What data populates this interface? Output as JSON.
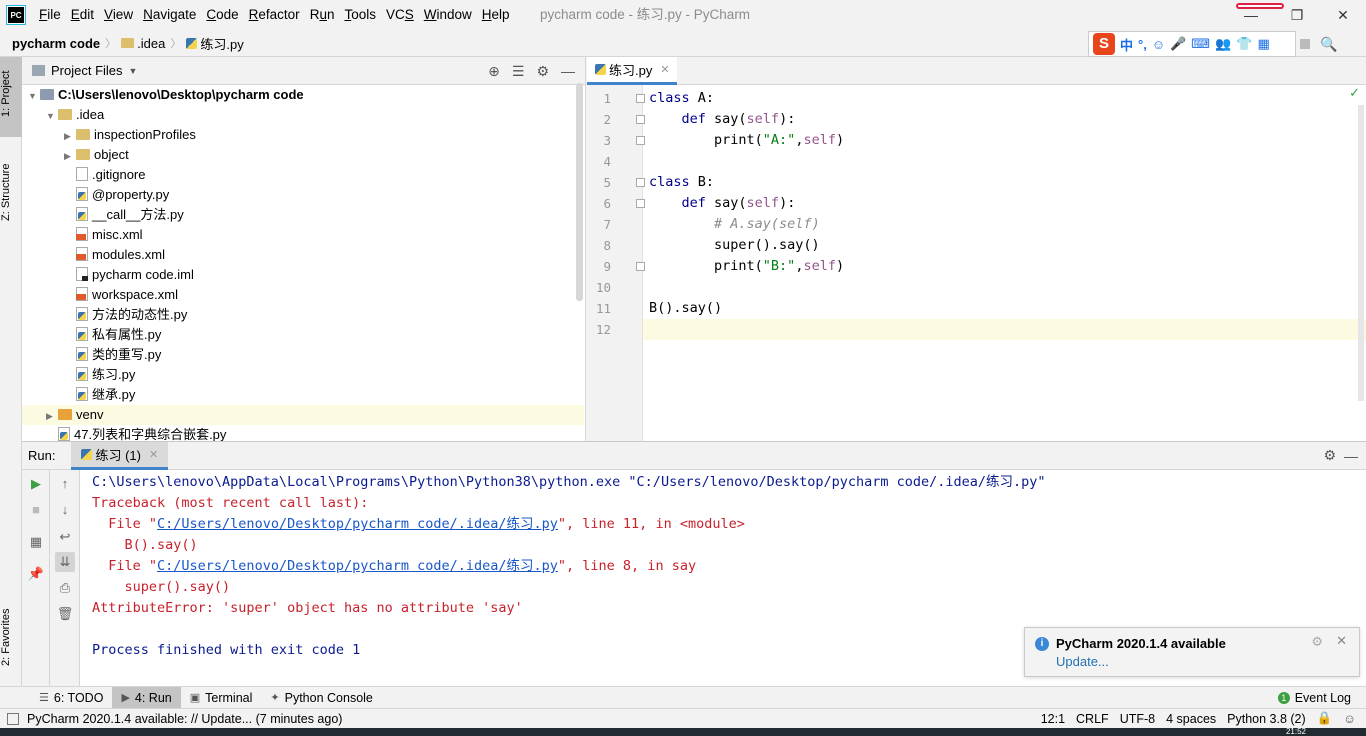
{
  "menubar": {
    "logo": "PC",
    "items": [
      {
        "pre": "",
        "u": "F",
        "post": "ile"
      },
      {
        "pre": "",
        "u": "E",
        "post": "dit"
      },
      {
        "pre": "",
        "u": "V",
        "post": "iew"
      },
      {
        "pre": "",
        "u": "N",
        "post": "avigate"
      },
      {
        "pre": "",
        "u": "C",
        "post": "ode"
      },
      {
        "pre": "",
        "u": "R",
        "post": "efactor"
      },
      {
        "pre": "R",
        "u": "u",
        "post": "n"
      },
      {
        "pre": "",
        "u": "T",
        "post": "ools"
      },
      {
        "pre": "VC",
        "u": "S",
        "post": ""
      },
      {
        "pre": "",
        "u": "W",
        "post": "indow"
      },
      {
        "pre": "",
        "u": "H",
        "post": "elp"
      }
    ],
    "window_title": "pycharm code - 练习.py - PyCharm"
  },
  "breadcrumb": {
    "root": "pycharm code",
    "folder": ".idea",
    "file": "练习.py"
  },
  "ime": {
    "logo": "S",
    "glyphs": [
      "中",
      "°,",
      "☺",
      "🎤",
      "⌨",
      "👥",
      "👕",
      "▦"
    ]
  },
  "project_panel": {
    "title": "Project Files",
    "tree": [
      {
        "label": "C:\\Users\\lenovo\\Desktop\\pycharm code",
        "depth": 0,
        "arrow": "▼",
        "icon": "folder-dark",
        "bold": true
      },
      {
        "label": ".idea",
        "depth": 1,
        "arrow": "▼",
        "icon": "folder"
      },
      {
        "label": "inspectionProfiles",
        "depth": 2,
        "arrow": "▶",
        "icon": "folder"
      },
      {
        "label": "object",
        "depth": 2,
        "arrow": "▶",
        "icon": "folder"
      },
      {
        "label": ".gitignore",
        "depth": 2,
        "arrow": "",
        "icon": "plain"
      },
      {
        "label": "@property.py",
        "depth": 2,
        "arrow": "",
        "icon": "py"
      },
      {
        "label": "__call__方法.py",
        "depth": 2,
        "arrow": "",
        "icon": "py"
      },
      {
        "label": "misc.xml",
        "depth": 2,
        "arrow": "",
        "icon": "xml"
      },
      {
        "label": "modules.xml",
        "depth": 2,
        "arrow": "",
        "icon": "xml"
      },
      {
        "label": "pycharm code.iml",
        "depth": 2,
        "arrow": "",
        "icon": "iml"
      },
      {
        "label": "workspace.xml",
        "depth": 2,
        "arrow": "",
        "icon": "xml"
      },
      {
        "label": "方法的动态性.py",
        "depth": 2,
        "arrow": "",
        "icon": "py"
      },
      {
        "label": "私有属性.py",
        "depth": 2,
        "arrow": "",
        "icon": "py"
      },
      {
        "label": "类的重写.py",
        "depth": 2,
        "arrow": "",
        "icon": "py"
      },
      {
        "label": "练习.py",
        "depth": 2,
        "arrow": "",
        "icon": "py"
      },
      {
        "label": "继承.py",
        "depth": 2,
        "arrow": "",
        "icon": "py"
      },
      {
        "label": "venv",
        "depth": 1,
        "arrow": "▶",
        "icon": "folder-orange",
        "highlight": true
      },
      {
        "label": "47.列表和字典综合嵌套.py",
        "depth": 1,
        "arrow": "",
        "icon": "py"
      }
    ]
  },
  "side_tabs": {
    "project": "1: Project",
    "structure": "Z: Structure",
    "favorites": "2: Favorites"
  },
  "editor": {
    "tab_label": "练习.py",
    "lines": [
      [
        {
          "t": "kw",
          "v": "class"
        },
        {
          "t": "",
          "v": " A:"
        }
      ],
      [
        {
          "t": "",
          "v": "    "
        },
        {
          "t": "kw",
          "v": "def"
        },
        {
          "t": "",
          "v": " say("
        },
        {
          "t": "self",
          "v": "self"
        },
        {
          "t": "",
          "v": "):"
        }
      ],
      [
        {
          "t": "",
          "v": "        print("
        },
        {
          "t": "str",
          "v": "\"A:\""
        },
        {
          "t": "",
          "v": ","
        },
        {
          "t": "self",
          "v": "self"
        },
        {
          "t": "",
          "v": ")"
        }
      ],
      [],
      [
        {
          "t": "kw",
          "v": "class"
        },
        {
          "t": "",
          "v": " B:"
        }
      ],
      [
        {
          "t": "",
          "v": "    "
        },
        {
          "t": "kw",
          "v": "def"
        },
        {
          "t": "",
          "v": " say("
        },
        {
          "t": "self",
          "v": "self"
        },
        {
          "t": "",
          "v": "):"
        }
      ],
      [
        {
          "t": "",
          "v": "        "
        },
        {
          "t": "cmt",
          "v": "# A.say(self)"
        }
      ],
      [
        {
          "t": "",
          "v": "        super().say()"
        }
      ],
      [
        {
          "t": "",
          "v": "        print("
        },
        {
          "t": "str",
          "v": "\"B:\""
        },
        {
          "t": "",
          "v": ","
        },
        {
          "t": "self",
          "v": "self"
        },
        {
          "t": "",
          "v": ")"
        }
      ],
      [],
      [
        {
          "t": "",
          "v": "B().say()"
        }
      ],
      []
    ],
    "current_line": 12
  },
  "run_panel": {
    "label": "Run:",
    "tab_label": "练习 (1)",
    "console": [
      [
        {
          "t": "con-normal",
          "v": "C:\\Users\\lenovo\\AppData\\Local\\Programs\\Python\\Python38\\python.exe \"C:/Users/lenovo/Desktop/pycharm code/.idea/练习.py\""
        }
      ],
      [
        {
          "t": "con-err",
          "v": "Traceback (most recent call last):"
        }
      ],
      [
        {
          "t": "con-err",
          "v": "  File \""
        },
        {
          "t": "con-link",
          "v": "C:/Users/lenovo/Desktop/pycharm code/.idea/练习.py"
        },
        {
          "t": "con-err",
          "v": "\", line 11, in <module>"
        }
      ],
      [
        {
          "t": "con-err",
          "v": "    B().say()"
        }
      ],
      [
        {
          "t": "con-err",
          "v": "  File \""
        },
        {
          "t": "con-link",
          "v": "C:/Users/lenovo/Desktop/pycharm code/.idea/练习.py"
        },
        {
          "t": "con-err",
          "v": "\", line 8, in say"
        }
      ],
      [
        {
          "t": "con-err",
          "v": "    super().say()"
        }
      ],
      [
        {
          "t": "con-err",
          "v": "AttributeError: 'super' object has no attribute 'say'"
        }
      ],
      [],
      [
        {
          "t": "con-normal",
          "v": "Process finished with exit code 1"
        }
      ]
    ]
  },
  "notification": {
    "title": "PyCharm 2020.1.4 available",
    "link": "Update..."
  },
  "tool_tabs": {
    "todo": "6: TODO",
    "run": "4: Run",
    "terminal": "Terminal",
    "python_console": "Python Console",
    "event_log": "Event Log"
  },
  "statusbar": {
    "message": "PyCharm 2020.1.4 available: // Update... (7 minutes ago)",
    "position": "12:1",
    "line_sep": "CRLF",
    "encoding": "UTF-8",
    "indent": "4 spaces",
    "interpreter": "Python 3.8 (2)"
  },
  "taskbar": {
    "clock": "21:52"
  }
}
